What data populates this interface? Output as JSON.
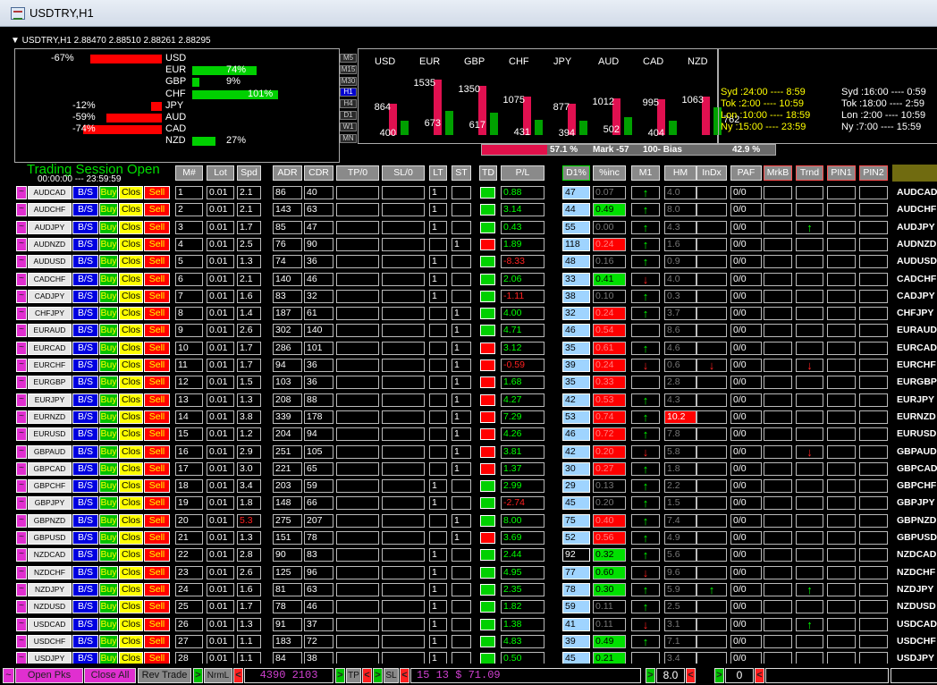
{
  "window": {
    "title": "USDTRY,H1"
  },
  "chart_info": "▼ USDTRY,H1  2.88470 2.88510 2.88261 2.88295",
  "strength": {
    "left": [
      {
        "name": "USD",
        "label": "-67%"
      },
      {
        "name": "EUR",
        "label": ""
      },
      {
        "name": "GBP",
        "label": ""
      },
      {
        "name": "CHF",
        "label": ""
      },
      {
        "name": "JPY",
        "label": "-12%"
      },
      {
        "name": "AUD",
        "label": "-59%"
      },
      {
        "name": "CAD",
        "label": "-74%"
      },
      {
        "name": "NZD",
        "label": ""
      }
    ],
    "right": [
      {
        "label": ""
      },
      {
        "label": "74%"
      },
      {
        "label": "9%"
      },
      {
        "label": "101%"
      },
      {
        "label": ""
      },
      {
        "label": ""
      },
      {
        "label": ""
      },
      {
        "label": "27%"
      }
    ]
  },
  "timeframes": [
    "M5",
    "M15",
    "M30",
    "H1",
    "H4",
    "D1",
    "W1",
    "MN"
  ],
  "selected_tf": "H1",
  "bars_chart": {
    "currencies": [
      "USD",
      "EUR",
      "GBP",
      "CHF",
      "JPY",
      "AUD",
      "CAD",
      "NZD"
    ],
    "red_values": [
      "864",
      "1535",
      "1350",
      "1075",
      "877",
      "1012",
      "995",
      "1063"
    ],
    "green_values": [
      "400",
      "673",
      "617",
      "431",
      "394",
      "502",
      "404",
      "762"
    ],
    "red_pct": 57.1,
    "red_label": "57.1 %",
    "mark_label": "Mark  -57",
    "bias_label": "100-  Bias",
    "green_label": "42.9 %"
  },
  "sessions": {
    "col1": [
      "Syd :24:00 ---- 8:59",
      "Tok :2:00 ---- 10:59",
      "Lon :10:00 ---- 18:59",
      "Ny :15:00 ---- 23:59"
    ],
    "col2": [
      "Syd :16:00 ---- 0:59",
      "Tok :18:00 ---- 2:59",
      "Lon :2:00 ---- 10:59",
      "Ny :7:00 ---- 15:59"
    ]
  },
  "session_status": {
    "title": "Trading Session Open",
    "time": "00:00:00 --- 23:59:59"
  },
  "headers": [
    "M#",
    "Lot",
    "Spd",
    "ADR",
    "CDR",
    "TP/0",
    "SL/0",
    "LT",
    "ST",
    "TD",
    "P/L",
    "D1%",
    "%inc",
    "M1",
    "HM",
    "InDx",
    "PAF",
    "MrkB",
    "Trnd",
    "PIN1",
    "PIN2"
  ],
  "button_labels": {
    "bs": "B/S",
    "buy": "Buy",
    "clos": "Clos",
    "sell": "Sell",
    "wave": "~"
  },
  "rows": [
    {
      "pair": "AUDCAD",
      "n": "1",
      "lot": "0.01",
      "spd": "2.1",
      "adr": "86",
      "cdr": "40",
      "lt": "1",
      "st": "",
      "td": "g",
      "pl": "0.88",
      "d1": "47",
      "inc": "0.07",
      "incc": "k",
      "m1": "up",
      "hm": "4.0",
      "hmc": "k",
      "indx": "",
      "paf": "0/0",
      "trnd": ""
    },
    {
      "pair": "AUDCHF",
      "n": "2",
      "lot": "0.01",
      "spd": "2.1",
      "adr": "143",
      "cdr": "63",
      "lt": "1",
      "st": "",
      "td": "g",
      "pl": "3.14",
      "d1": "44",
      "inc": "0.49",
      "incc": "g",
      "m1": "up",
      "hm": "8.0",
      "hmc": "k",
      "indx": "",
      "paf": "0/0",
      "trnd": ""
    },
    {
      "pair": "AUDJPY",
      "n": "3",
      "lot": "0.01",
      "spd": "1.7",
      "adr": "85",
      "cdr": "47",
      "lt": "1",
      "st": "",
      "td": "g",
      "pl": "0.43",
      "d1": "55",
      "inc": "0.00",
      "incc": "k",
      "m1": "up",
      "hm": "4.3",
      "hmc": "k",
      "indx": "",
      "paf": "0/0",
      "trnd": "up"
    },
    {
      "pair": "AUDNZD",
      "n": "4",
      "lot": "0.01",
      "spd": "2.5",
      "adr": "76",
      "cdr": "90",
      "lt": "",
      "st": "1",
      "td": "r",
      "pl": "1.89",
      "d1": "118",
      "inc": "0.24",
      "incc": "r",
      "m1": "up",
      "hm": "1.6",
      "hmc": "k",
      "indx": "",
      "paf": "0/0",
      "trnd": ""
    },
    {
      "pair": "AUDUSD",
      "n": "5",
      "lot": "0.01",
      "spd": "1.3",
      "adr": "74",
      "cdr": "36",
      "lt": "1",
      "st": "",
      "td": "g",
      "pl": "-8.33",
      "d1": "48",
      "inc": "0.16",
      "incc": "k",
      "m1": "up",
      "hm": "0.9",
      "hmc": "k",
      "indx": "",
      "paf": "0/0",
      "trnd": ""
    },
    {
      "pair": "CADCHF",
      "n": "6",
      "lot": "0.01",
      "spd": "2.1",
      "adr": "140",
      "cdr": "46",
      "lt": "1",
      "st": "",
      "td": "g",
      "pl": "2.06",
      "d1": "33",
      "inc": "0.41",
      "incc": "g",
      "m1": "dn",
      "hm": "4.0",
      "hmc": "k",
      "indx": "",
      "paf": "0/0",
      "trnd": ""
    },
    {
      "pair": "CADJPY",
      "n": "7",
      "lot": "0.01",
      "spd": "1.6",
      "adr": "83",
      "cdr": "32",
      "lt": "1",
      "st": "",
      "td": "g",
      "pl": "-1.11",
      "d1": "38",
      "inc": "0.10",
      "incc": "k",
      "m1": "up",
      "hm": "0.3",
      "hmc": "k",
      "indx": "",
      "paf": "0/0",
      "trnd": ""
    },
    {
      "pair": "CHFJPY",
      "n": "8",
      "lot": "0.01",
      "spd": "1.4",
      "adr": "187",
      "cdr": "61",
      "lt": "",
      "st": "1",
      "td": "g",
      "pl": "4.00",
      "d1": "32",
      "inc": "0.24",
      "incc": "r",
      "m1": "up",
      "hm": "3.7",
      "hmc": "k",
      "indx": "",
      "paf": "0/0",
      "trnd": ""
    },
    {
      "pair": "EURAUD",
      "n": "9",
      "lot": "0.01",
      "spd": "2.6",
      "adr": "302",
      "cdr": "140",
      "lt": "",
      "st": "1",
      "td": "g",
      "pl": "4.71",
      "d1": "46",
      "inc": "0.54",
      "incc": "r",
      "m1": "",
      "hm": "8.6",
      "hmc": "k",
      "indx": "",
      "paf": "0/0",
      "trnd": ""
    },
    {
      "pair": "EURCAD",
      "n": "10",
      "lot": "0.01",
      "spd": "1.7",
      "adr": "286",
      "cdr": "101",
      "lt": "",
      "st": "1",
      "td": "r",
      "pl": "3.12",
      "d1": "35",
      "inc": "0.61",
      "incc": "r",
      "m1": "up",
      "hm": "4.6",
      "hmc": "k",
      "indx": "",
      "paf": "0/0",
      "trnd": ""
    },
    {
      "pair": "EURCHF",
      "n": "11",
      "lot": "0.01",
      "spd": "1.7",
      "adr": "94",
      "cdr": "36",
      "lt": "",
      "st": "1",
      "td": "r",
      "pl": "-0.59",
      "d1": "39",
      "inc": "0.24",
      "incc": "r",
      "m1": "dn",
      "hm": "0.6",
      "hmc": "k",
      "indx": "dn",
      "paf": "0/0",
      "trnd": "dn"
    },
    {
      "pair": "EURGBP",
      "n": "12",
      "lot": "0.01",
      "spd": "1.5",
      "adr": "103",
      "cdr": "36",
      "lt": "",
      "st": "1",
      "td": "r",
      "pl": "1.68",
      "d1": "35",
      "inc": "0.33",
      "incc": "r",
      "m1": "",
      "hm": "2.8",
      "hmc": "k",
      "indx": "",
      "paf": "0/0",
      "trnd": ""
    },
    {
      "pair": "EURJPY",
      "n": "13",
      "lot": "0.01",
      "spd": "1.3",
      "adr": "208",
      "cdr": "88",
      "lt": "",
      "st": "1",
      "td": "r",
      "pl": "4.27",
      "d1": "42",
      "inc": "0.53",
      "incc": "r",
      "m1": "up",
      "hm": "4.3",
      "hmc": "k",
      "indx": "",
      "paf": "0/0",
      "trnd": ""
    },
    {
      "pair": "EURNZD",
      "n": "14",
      "lot": "0.01",
      "spd": "3.8",
      "adr": "339",
      "cdr": "178",
      "lt": "",
      "st": "1",
      "td": "r",
      "pl": "7.29",
      "d1": "53",
      "inc": "0.74",
      "incc": "r",
      "m1": "up",
      "hm": "10.2",
      "hmc": "r",
      "indx": "",
      "paf": "0/0",
      "trnd": ""
    },
    {
      "pair": "EURUSD",
      "n": "15",
      "lot": "0.01",
      "spd": "1.2",
      "adr": "204",
      "cdr": "94",
      "lt": "",
      "st": "1",
      "td": "r",
      "pl": "4.26",
      "d1": "46",
      "inc": "0.72",
      "incc": "r",
      "m1": "up",
      "hm": "7.8",
      "hmc": "k",
      "indx": "",
      "paf": "0/0",
      "trnd": ""
    },
    {
      "pair": "GBPAUD",
      "n": "16",
      "lot": "0.01",
      "spd": "2.9",
      "adr": "251",
      "cdr": "105",
      "lt": "",
      "st": "1",
      "td": "r",
      "pl": "3.81",
      "d1": "42",
      "inc": "0.20",
      "incc": "r",
      "m1": "dn",
      "hm": "5.8",
      "hmc": "k",
      "indx": "",
      "paf": "0/0",
      "trnd": "dn"
    },
    {
      "pair": "GBPCAD",
      "n": "17",
      "lot": "0.01",
      "spd": "3.0",
      "adr": "221",
      "cdr": "65",
      "lt": "",
      "st": "1",
      "td": "r",
      "pl": "1.37",
      "d1": "30",
      "inc": "0.27",
      "incc": "r",
      "m1": "up",
      "hm": "1.8",
      "hmc": "k",
      "indx": "",
      "paf": "0/0",
      "trnd": ""
    },
    {
      "pair": "GBPCHF",
      "n": "18",
      "lot": "0.01",
      "spd": "3.4",
      "adr": "203",
      "cdr": "59",
      "lt": "1",
      "st": "",
      "td": "g",
      "pl": "2.99",
      "d1": "29",
      "inc": "0.13",
      "incc": "k",
      "m1": "up",
      "hm": "2.2",
      "hmc": "k",
      "indx": "",
      "paf": "0/0",
      "trnd": ""
    },
    {
      "pair": "GBPJPY",
      "n": "19",
      "lot": "0.01",
      "spd": "1.8",
      "adr": "148",
      "cdr": "66",
      "lt": "1",
      "st": "",
      "td": "g",
      "pl": "-2.74",
      "d1": "45",
      "inc": "0.20",
      "incc": "k",
      "m1": "up",
      "hm": "1.5",
      "hmc": "k",
      "indx": "",
      "paf": "0/0",
      "trnd": ""
    },
    {
      "pair": "GBPNZD",
      "n": "20",
      "lot": "0.01",
      "spd": "5.3",
      "spdc": "r",
      "adr": "275",
      "cdr": "207",
      "lt": "",
      "st": "1",
      "td": "g",
      "pl": "8.00",
      "d1": "75",
      "inc": "0.40",
      "incc": "r",
      "m1": "up",
      "hm": "7.4",
      "hmc": "k",
      "indx": "",
      "paf": "0/0",
      "trnd": ""
    },
    {
      "pair": "GBPUSD",
      "n": "21",
      "lot": "0.01",
      "spd": "1.3",
      "adr": "151",
      "cdr": "78",
      "lt": "",
      "st": "1",
      "td": "r",
      "pl": "3.69",
      "d1": "52",
      "inc": "0.56",
      "incc": "r",
      "m1": "up",
      "hm": "4.9",
      "hmc": "k",
      "indx": "",
      "paf": "0/0",
      "trnd": ""
    },
    {
      "pair": "NZDCAD",
      "n": "22",
      "lot": "0.01",
      "spd": "2.8",
      "adr": "90",
      "cdr": "83",
      "lt": "1",
      "st": "",
      "td": "g",
      "pl": "2.44",
      "d1": "92",
      "d1c": "k",
      "inc": "0.32",
      "incc": "g",
      "m1": "up",
      "hm": "5.6",
      "hmc": "k",
      "indx": "",
      "paf": "0/0",
      "trnd": ""
    },
    {
      "pair": "NZDCHF",
      "n": "23",
      "lot": "0.01",
      "spd": "2.6",
      "adr": "125",
      "cdr": "96",
      "lt": "1",
      "st": "",
      "td": "g",
      "pl": "4.95",
      "d1": "77",
      "inc": "0.60",
      "incc": "g",
      "m1": "dn",
      "hm": "9.6",
      "hmc": "k",
      "indx": "",
      "paf": "0/0",
      "trnd": ""
    },
    {
      "pair": "NZDJPY",
      "n": "24",
      "lot": "0.01",
      "spd": "1.6",
      "adr": "81",
      "cdr": "63",
      "lt": "1",
      "st": "",
      "td": "g",
      "pl": "2.35",
      "d1": "78",
      "inc": "0.30",
      "incc": "g",
      "m1": "up",
      "hm": "5.9",
      "hmc": "k",
      "indx": "up",
      "paf": "0/0",
      "trnd": "up"
    },
    {
      "pair": "NZDUSD",
      "n": "25",
      "lot": "0.01",
      "spd": "1.7",
      "adr": "78",
      "cdr": "46",
      "lt": "1",
      "st": "",
      "td": "g",
      "pl": "1.82",
      "d1": "59",
      "inc": "0.11",
      "incc": "k",
      "m1": "up",
      "hm": "2.5",
      "hmc": "k",
      "indx": "",
      "paf": "0/0",
      "trnd": ""
    },
    {
      "pair": "USDCAD",
      "n": "26",
      "lot": "0.01",
      "spd": "1.3",
      "adr": "91",
      "cdr": "37",
      "lt": "1",
      "st": "",
      "td": "g",
      "pl": "1.38",
      "d1": "41",
      "inc": "0.11",
      "incc": "k",
      "m1": "dn",
      "hm": "3.1",
      "hmc": "k",
      "indx": "",
      "paf": "0/0",
      "trnd": "up"
    },
    {
      "pair": "USDCHF",
      "n": "27",
      "lot": "0.01",
      "spd": "1.1",
      "adr": "183",
      "cdr": "72",
      "lt": "1",
      "st": "",
      "td": "g",
      "pl": "4.83",
      "d1": "39",
      "inc": "0.49",
      "incc": "g",
      "m1": "up",
      "hm": "7.1",
      "hmc": "k",
      "indx": "",
      "paf": "0/0",
      "trnd": ""
    },
    {
      "pair": "USDJPY",
      "n": "28",
      "lot": "0.01",
      "spd": "1.1",
      "adr": "84",
      "cdr": "38",
      "lt": "1",
      "st": "",
      "td": "g",
      "pl": "0.50",
      "d1": "45",
      "inc": "0.21",
      "incc": "g",
      "m1": "",
      "hm": "3.4",
      "hmc": "k",
      "indx": "",
      "paf": "0/0",
      "trnd": ""
    }
  ],
  "bottom": {
    "wave": "~",
    "open_pks": "Open Pks",
    "close_all": "Close All",
    "rev_trade": "Rev Trade",
    "arrow_right": ">",
    "arrow_left": "<",
    "nrml": "NrmL",
    "val1": "4390 2103",
    "tp": "TP",
    "sl": "SL",
    "val2": "15 13 $ 71.09",
    "val3": "8.0",
    "val4": "0"
  }
}
